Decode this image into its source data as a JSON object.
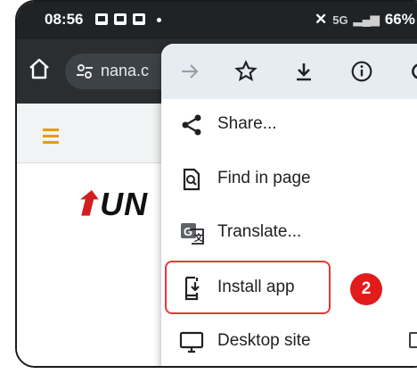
{
  "status_bar": {
    "time": "08:56",
    "battery": "66%",
    "signal_label": "5G"
  },
  "browser": {
    "url_text": "nana.c"
  },
  "page": {
    "logo_text": "UN"
  },
  "menu": {
    "top_icons": [
      "forward-icon",
      "star-icon",
      "download-icon",
      "info-icon",
      "refresh-icon"
    ],
    "items": [
      {
        "label": "Share...",
        "icon": "share-icon"
      },
      {
        "label": "Find in page",
        "icon": "find-in-page-icon"
      },
      {
        "label": "Translate...",
        "icon": "translate-icon"
      },
      {
        "label": "Install app",
        "icon": "install-app-icon"
      },
      {
        "label": "Desktop site",
        "icon": "desktop-icon"
      }
    ],
    "desktop_site_checked": false
  },
  "annotation": {
    "step_number": "2",
    "highlight_color": "#e53935",
    "badge_color": "#e31b1b"
  }
}
